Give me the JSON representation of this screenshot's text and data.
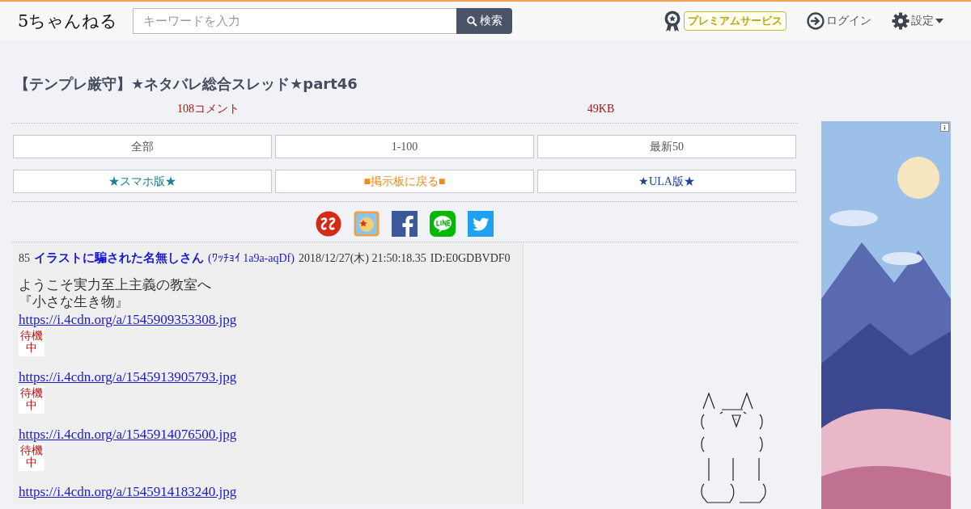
{
  "header": {
    "logo": "5ちゃんねる",
    "search": {
      "placeholder": "キーワードを入力",
      "button": "検索"
    },
    "premium": "プレミアムサービス",
    "login": "ログイン",
    "settings": "設定"
  },
  "thread": {
    "title": "【テンプレ厳守】★ネタバレ総合スレッド★part46",
    "comments": "108コメント",
    "size": "49KB"
  },
  "nav_buttons": [
    "全部",
    "1-100",
    "最新50"
  ],
  "links": [
    {
      "label": "★スマホ版★",
      "color": "#1a7f8e"
    },
    {
      "label": "■掲示板に戻る■",
      "color": "#f08c1e"
    },
    {
      "label": "★ULA版★",
      "color": "#1e3fa0"
    }
  ],
  "post": {
    "number": "85",
    "name": "イラストに騙された名無しさん",
    "trip": "(ﾜｯﾁｮｲ 1a9a-aqDf)",
    "date": "2018/12/27(木) 21:50:18.35",
    "id": "ID:E0GDBVDF0",
    "lines": [
      "ようこそ実力至上主義の教室へ",
      "『小さな生き物』"
    ],
    "images": [
      {
        "url": "https://i.4cdn.org/a/1545909353308.jpg",
        "thumb": "待機中"
      },
      {
        "url": "https://i.4cdn.org/a/1545913905793.jpg",
        "thumb": "待機中"
      },
      {
        "url": "https://i.4cdn.org/a/1545914076500.jpg",
        "thumb": "待機中"
      },
      {
        "url": "https://i.4cdn.org/a/1545914183240.jpg"
      }
    ]
  }
}
